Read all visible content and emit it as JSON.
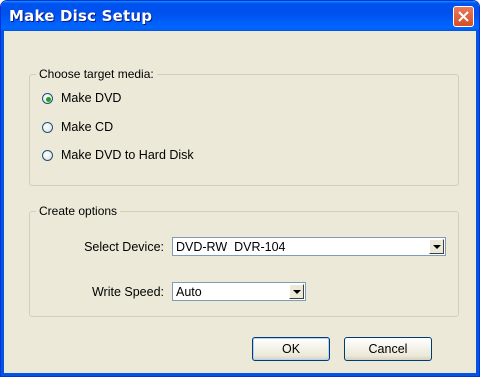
{
  "window": {
    "title": "Make Disc Setup"
  },
  "media_group": {
    "legend": "Choose target media:",
    "options": [
      {
        "label": "Make DVD",
        "selected": true
      },
      {
        "label": "Make CD",
        "selected": false
      },
      {
        "label": "Make DVD to Hard Disk",
        "selected": false
      }
    ]
  },
  "options_group": {
    "legend": "Create options",
    "device_label": "Select Device:",
    "device_value": "DVD-RW  DVR-104",
    "speed_label": "Write Speed:",
    "speed_value": "Auto"
  },
  "buttons": {
    "ok": "OK",
    "cancel": "Cancel"
  },
  "colors": {
    "titlebar": "#0054e3",
    "close": "#d64e25",
    "face": "#ece9d8",
    "radio_dot": "#21a121"
  }
}
